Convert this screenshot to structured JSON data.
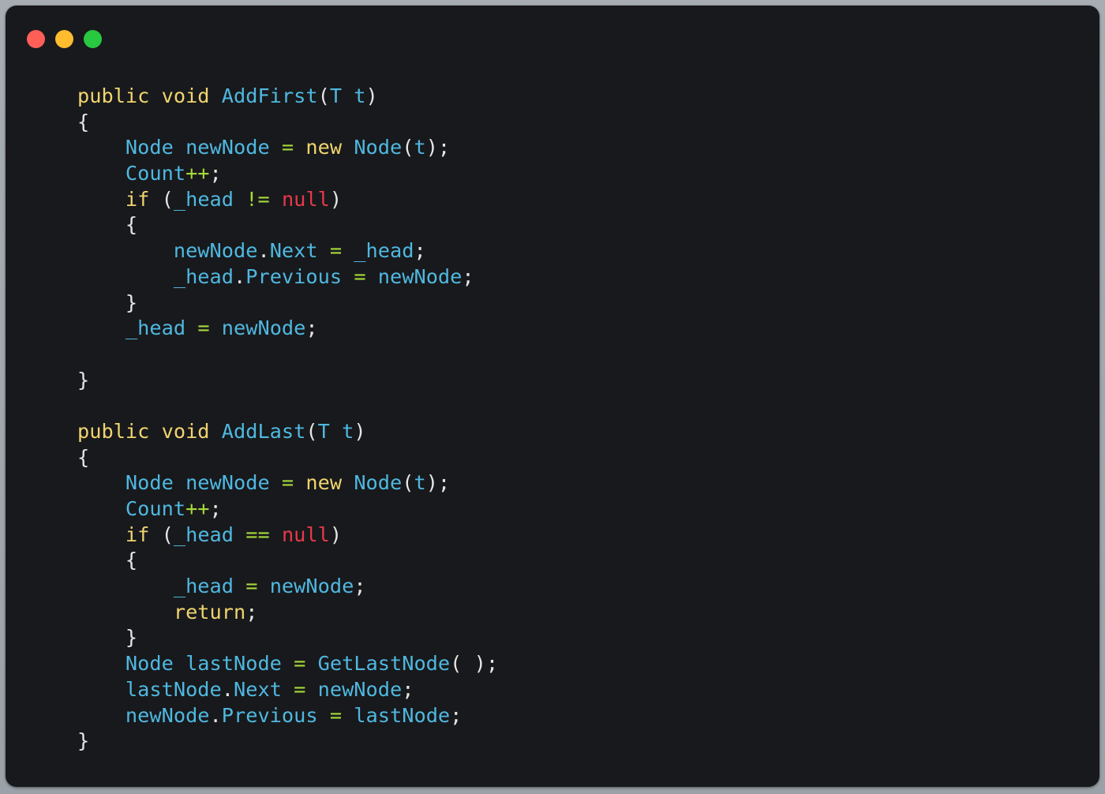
{
  "window": {
    "controls": [
      {
        "name": "close",
        "color": "#ff5f57"
      },
      {
        "name": "minimize",
        "color": "#febc2e"
      },
      {
        "name": "maximize",
        "color": "#28c840"
      }
    ]
  },
  "colors": {
    "keyword": "#f0d46e",
    "identifier": "#4fb8e0",
    "operator": "#a6d93a",
    "null_literal": "#e8394a",
    "punctuation": "#e6e6e6",
    "background": "#18191c"
  },
  "code": {
    "language": "C#",
    "lines": [
      [
        {
          "t": "public void ",
          "c": "kw"
        },
        {
          "t": "AddFirst",
          "c": "id"
        },
        {
          "t": "(",
          "c": "pn"
        },
        {
          "t": "T t",
          "c": "id"
        },
        {
          "t": ")",
          "c": "pn"
        }
      ],
      [
        {
          "t": "{",
          "c": "pn"
        }
      ],
      [
        {
          "t": "    Node newNode ",
          "c": "id"
        },
        {
          "t": "=",
          "c": "op"
        },
        {
          "t": " new ",
          "c": "kw"
        },
        {
          "t": "Node",
          "c": "id"
        },
        {
          "t": "(",
          "c": "pn"
        },
        {
          "t": "t",
          "c": "id"
        },
        {
          "t": ");",
          "c": "pn"
        }
      ],
      [
        {
          "t": "    Count",
          "c": "id"
        },
        {
          "t": "++",
          "c": "op"
        },
        {
          "t": ";",
          "c": "pn"
        }
      ],
      [
        {
          "t": "    if ",
          "c": "kw"
        },
        {
          "t": "(",
          "c": "pn"
        },
        {
          "t": "_head ",
          "c": "id"
        },
        {
          "t": "!=",
          "c": "op"
        },
        {
          "t": " null",
          "c": "nl"
        },
        {
          "t": ")",
          "c": "pn"
        }
      ],
      [
        {
          "t": "    {",
          "c": "pn"
        }
      ],
      [
        {
          "t": "        newNode",
          "c": "id"
        },
        {
          "t": ".",
          "c": "pn"
        },
        {
          "t": "Next ",
          "c": "id"
        },
        {
          "t": "=",
          "c": "op"
        },
        {
          "t": " _head",
          "c": "id"
        },
        {
          "t": ";",
          "c": "pn"
        }
      ],
      [
        {
          "t": "        _head",
          "c": "id"
        },
        {
          "t": ".",
          "c": "pn"
        },
        {
          "t": "Previous ",
          "c": "id"
        },
        {
          "t": "=",
          "c": "op"
        },
        {
          "t": " newNode",
          "c": "id"
        },
        {
          "t": ";",
          "c": "pn"
        }
      ],
      [
        {
          "t": "    }",
          "c": "pn"
        }
      ],
      [
        {
          "t": "    _head ",
          "c": "id"
        },
        {
          "t": "=",
          "c": "op"
        },
        {
          "t": " newNode",
          "c": "id"
        },
        {
          "t": ";",
          "c": "pn"
        }
      ],
      [],
      [
        {
          "t": "}",
          "c": "pn"
        }
      ],
      [],
      [
        {
          "t": "public void ",
          "c": "kw"
        },
        {
          "t": "AddLast",
          "c": "id"
        },
        {
          "t": "(",
          "c": "pn"
        },
        {
          "t": "T t",
          "c": "id"
        },
        {
          "t": ")",
          "c": "pn"
        }
      ],
      [
        {
          "t": "{",
          "c": "pn"
        }
      ],
      [
        {
          "t": "    Node newNode ",
          "c": "id"
        },
        {
          "t": "=",
          "c": "op"
        },
        {
          "t": " new ",
          "c": "kw"
        },
        {
          "t": "Node",
          "c": "id"
        },
        {
          "t": "(",
          "c": "pn"
        },
        {
          "t": "t",
          "c": "id"
        },
        {
          "t": ");",
          "c": "pn"
        }
      ],
      [
        {
          "t": "    Count",
          "c": "id"
        },
        {
          "t": "++",
          "c": "op"
        },
        {
          "t": ";",
          "c": "pn"
        }
      ],
      [
        {
          "t": "    if ",
          "c": "kw"
        },
        {
          "t": "(",
          "c": "pn"
        },
        {
          "t": "_head ",
          "c": "id"
        },
        {
          "t": "==",
          "c": "op"
        },
        {
          "t": " null",
          "c": "nl"
        },
        {
          "t": ")",
          "c": "pn"
        }
      ],
      [
        {
          "t": "    {",
          "c": "pn"
        }
      ],
      [
        {
          "t": "        _head ",
          "c": "id"
        },
        {
          "t": "=",
          "c": "op"
        },
        {
          "t": " newNode",
          "c": "id"
        },
        {
          "t": ";",
          "c": "pn"
        }
      ],
      [
        {
          "t": "        return",
          "c": "kw"
        },
        {
          "t": ";",
          "c": "pn"
        }
      ],
      [
        {
          "t": "    }",
          "c": "pn"
        }
      ],
      [
        {
          "t": "    Node lastNode ",
          "c": "id"
        },
        {
          "t": "=",
          "c": "op"
        },
        {
          "t": " GetLastNode",
          "c": "id"
        },
        {
          "t": "( );",
          "c": "pn"
        }
      ],
      [
        {
          "t": "    lastNode",
          "c": "id"
        },
        {
          "t": ".",
          "c": "pn"
        },
        {
          "t": "Next ",
          "c": "id"
        },
        {
          "t": "=",
          "c": "op"
        },
        {
          "t": " newNode",
          "c": "id"
        },
        {
          "t": ";",
          "c": "pn"
        }
      ],
      [
        {
          "t": "    newNode",
          "c": "id"
        },
        {
          "t": ".",
          "c": "pn"
        },
        {
          "t": "Previous ",
          "c": "id"
        },
        {
          "t": "=",
          "c": "op"
        },
        {
          "t": " lastNode",
          "c": "id"
        },
        {
          "t": ";",
          "c": "pn"
        }
      ],
      [
        {
          "t": "}",
          "c": "pn"
        }
      ]
    ]
  }
}
